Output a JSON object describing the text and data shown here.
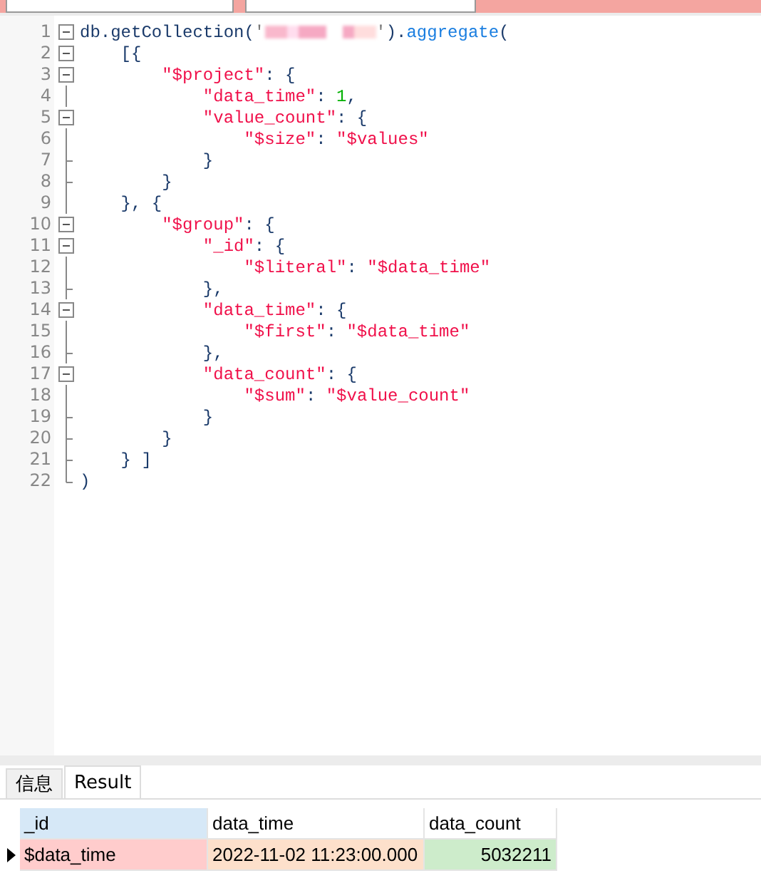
{
  "editor": {
    "lines": [
      {
        "number": "1",
        "kind": "start",
        "tokens": [
          {
            "kind": "plain",
            "text": "db.getCollection("
          },
          {
            "kind": "tick",
            "text": "'"
          },
          {
            "kind": "redacted"
          },
          {
            "kind": "tick",
            "text": "'"
          },
          {
            "kind": "plain",
            "text": ")."
          },
          {
            "kind": "func",
            "text": "aggregate"
          },
          {
            "kind": "plain",
            "text": "("
          }
        ]
      },
      {
        "number": "2",
        "kind": "start",
        "tokens": [
          {
            "kind": "plain",
            "text": "    [{"
          }
        ]
      },
      {
        "number": "3",
        "kind": "start",
        "tokens": [
          {
            "kind": "string",
            "text": "        \"$project\""
          },
          {
            "kind": "plain",
            "text": ": {"
          }
        ]
      },
      {
        "number": "4",
        "kind": "body",
        "tokens": [
          {
            "kind": "string",
            "text": "            \"data_time\""
          },
          {
            "kind": "plain",
            "text": ": "
          },
          {
            "kind": "number",
            "text": "1"
          },
          {
            "kind": "plain",
            "text": ","
          }
        ]
      },
      {
        "number": "5",
        "kind": "start",
        "tokens": [
          {
            "kind": "string",
            "text": "            \"value_count\""
          },
          {
            "kind": "plain",
            "text": ": {"
          }
        ]
      },
      {
        "number": "6",
        "kind": "body",
        "tokens": [
          {
            "kind": "string",
            "text": "                \"$size\""
          },
          {
            "kind": "plain",
            "text": ": "
          },
          {
            "kind": "string",
            "text": "\"$values\""
          }
        ]
      },
      {
        "number": "7",
        "kind": "end",
        "tokens": [
          {
            "kind": "plain",
            "text": "            }"
          }
        ]
      },
      {
        "number": "8",
        "kind": "end",
        "tokens": [
          {
            "kind": "plain",
            "text": "        }"
          }
        ]
      },
      {
        "number": "9",
        "kind": "body",
        "tokens": [
          {
            "kind": "plain",
            "text": "    }, {"
          }
        ]
      },
      {
        "number": "10",
        "kind": "start",
        "tokens": [
          {
            "kind": "string",
            "text": "        \"$group\""
          },
          {
            "kind": "plain",
            "text": ": {"
          }
        ]
      },
      {
        "number": "11",
        "kind": "start",
        "tokens": [
          {
            "kind": "string",
            "text": "            \"_id\""
          },
          {
            "kind": "plain",
            "text": ": {"
          }
        ]
      },
      {
        "number": "12",
        "kind": "body",
        "tokens": [
          {
            "kind": "string",
            "text": "                \"$literal\""
          },
          {
            "kind": "plain",
            "text": ": "
          },
          {
            "kind": "string",
            "text": "\"$data_time\""
          }
        ]
      },
      {
        "number": "13",
        "kind": "end",
        "tokens": [
          {
            "kind": "plain",
            "text": "            },"
          }
        ]
      },
      {
        "number": "14",
        "kind": "start",
        "tokens": [
          {
            "kind": "string",
            "text": "            \"data_time\""
          },
          {
            "kind": "plain",
            "text": ": {"
          }
        ]
      },
      {
        "number": "15",
        "kind": "body",
        "tokens": [
          {
            "kind": "string",
            "text": "                \"$first\""
          },
          {
            "kind": "plain",
            "text": ": "
          },
          {
            "kind": "string",
            "text": "\"$data_time\""
          }
        ]
      },
      {
        "number": "16",
        "kind": "end",
        "tokens": [
          {
            "kind": "plain",
            "text": "            },"
          }
        ]
      },
      {
        "number": "17",
        "kind": "start",
        "tokens": [
          {
            "kind": "string",
            "text": "            \"data_count\""
          },
          {
            "kind": "plain",
            "text": ": {"
          }
        ]
      },
      {
        "number": "18",
        "kind": "body",
        "tokens": [
          {
            "kind": "string",
            "text": "                \"$sum\""
          },
          {
            "kind": "plain",
            "text": ": "
          },
          {
            "kind": "string",
            "text": "\"$value_count\""
          }
        ]
      },
      {
        "number": "19",
        "kind": "end",
        "tokens": [
          {
            "kind": "plain",
            "text": "            }"
          }
        ]
      },
      {
        "number": "20",
        "kind": "end",
        "tokens": [
          {
            "kind": "plain",
            "text": "        }"
          }
        ]
      },
      {
        "number": "21",
        "kind": "end",
        "tokens": [
          {
            "kind": "plain",
            "text": "    } ]"
          }
        ]
      },
      {
        "number": "22",
        "kind": "last",
        "tokens": [
          {
            "kind": "plain",
            "text": ")"
          }
        ]
      }
    ]
  },
  "tabs": [
    {
      "label": "信息",
      "selected": false
    },
    {
      "label": "Result",
      "selected": true
    }
  ],
  "table": {
    "columns": [
      {
        "label": "_id",
        "selected": true
      },
      {
        "label": "data_time",
        "selected": false
      },
      {
        "label": "data_count",
        "selected": false
      }
    ],
    "rows": [
      {
        "current": true,
        "cells": [
          {
            "text": "$data_time",
            "kind": "text",
            "color": "#ffcccc"
          },
          {
            "text": "2022-11-02 11:23:00.000",
            "kind": "text",
            "color": "#fde0cb"
          },
          {
            "text": "5032211",
            "kind": "number",
            "color": "#cdeccb"
          }
        ]
      }
    ]
  }
}
